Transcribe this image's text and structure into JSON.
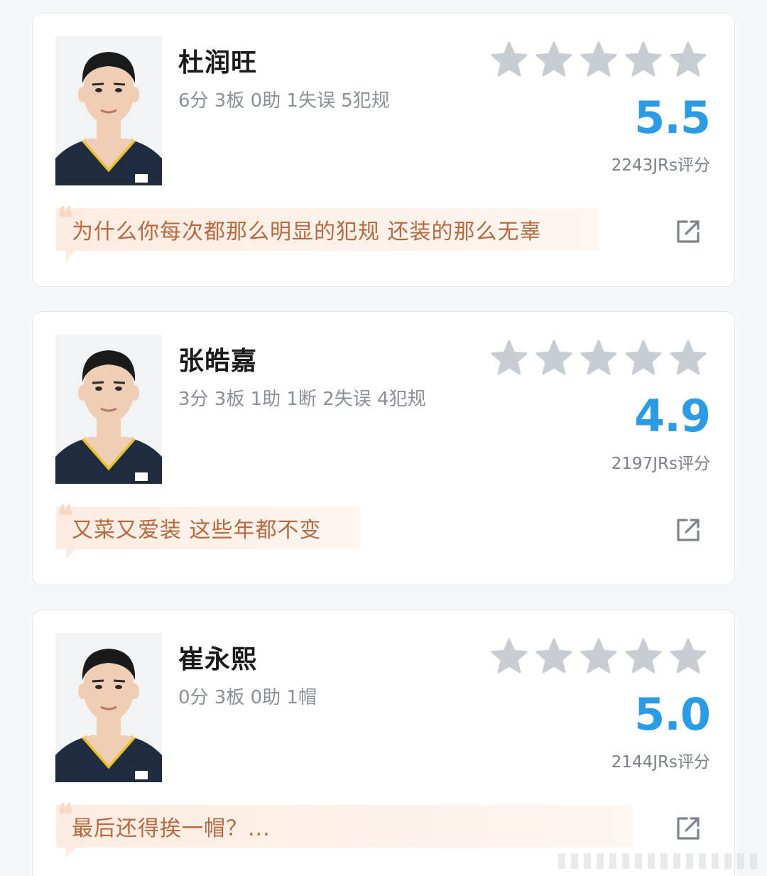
{
  "players": [
    {
      "name": "杜润旺",
      "stats": "6分 3板 0助 1失误 5犯规",
      "rating": "5.5",
      "rating_count": "2243JRs评分",
      "comment": "为什么你每次都那么明显的犯规 还装的那么无辜",
      "stars_filled": 0,
      "stars_total": 5
    },
    {
      "name": "张皓嘉",
      "stats": "3分 3板 1助 1断 2失误 4犯规",
      "rating": "4.9",
      "rating_count": "2197JRs评分",
      "comment": "又菜又爱装 这些年都不变",
      "stars_filled": 0,
      "stars_total": 5
    },
    {
      "name": "崔永熙",
      "stats": "0分 3板 0助 1帽",
      "rating": "5.0",
      "rating_count": "2144JRs评分",
      "comment": "最后还得挨一帽？...",
      "stars_filled": 0,
      "stars_total": 5
    }
  ],
  "colors": {
    "rating": "#2b9be6",
    "star_empty": "#c8ccd3",
    "comment_text": "#b7693f",
    "comment_bg": "#fdece1"
  },
  "icons": {
    "star": "star-icon",
    "share": "share-external-icon",
    "quote": "quote-icon",
    "photo": "player-photo"
  }
}
